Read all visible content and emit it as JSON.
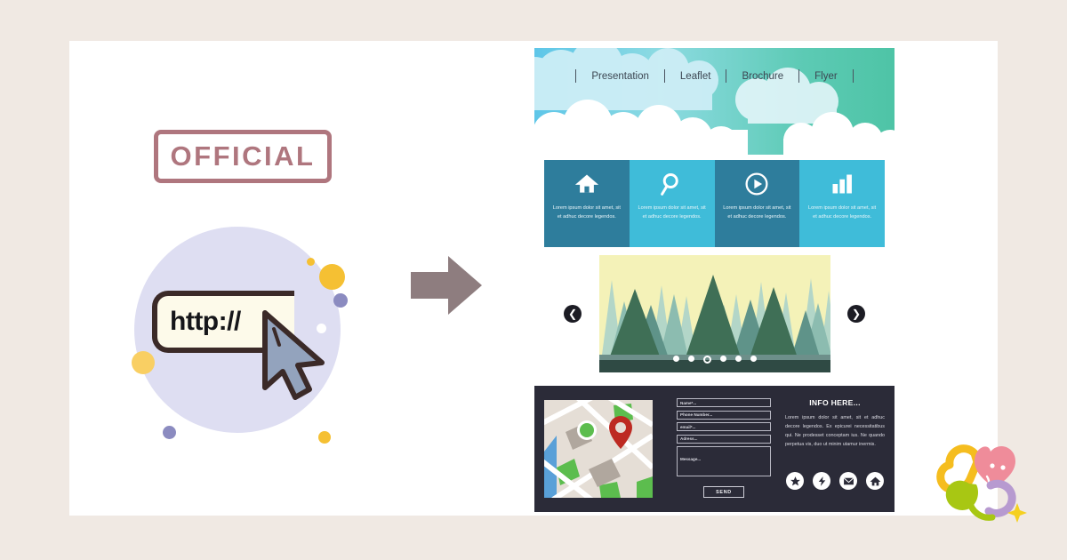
{
  "page": {
    "background_color": "#f0e9e3",
    "card_color": "#ffffff"
  },
  "left_panel": {
    "stamp": {
      "label": "OFFICIAL",
      "color": "#a96b74"
    },
    "url_bar": {
      "text": "http://",
      "fill": "#fdfaea",
      "stroke": "#3b2a28"
    },
    "cursor_icon": "mouse-pointer-icon",
    "circle_color": "#dedef2",
    "accent_yellow": "#f5c033",
    "accent_purple": "#8b8bc0",
    "arrow_icon": "right-arrow-icon",
    "arrow_color": "#8e7d7f"
  },
  "mockup": {
    "hero": {
      "sky_left": "#7fd0e8",
      "sky_right": "#55c9b0",
      "cloud_color": "#ffffff",
      "nav": [
        {
          "label": "Presentation"
        },
        {
          "label": "Leaflet"
        },
        {
          "label": "Brochure"
        },
        {
          "label": "Flyer"
        }
      ]
    },
    "tiles": [
      {
        "icon": "home-icon",
        "text": "Lorem ipsum dolor sit amet, sit et adhuc decore legendos.",
        "bg": "#2e7d9c"
      },
      {
        "icon": "search-icon",
        "text": "Lorem ipsum dolor sit amet, sit et adhuc decore legendos.",
        "bg": "#3fbcd9"
      },
      {
        "icon": "play-icon",
        "text": "Lorem ipsum dolor sit amet, sit et adhuc decore legendos.",
        "bg": "#2e7d9c"
      },
      {
        "icon": "bar-chart-icon",
        "text": "Lorem ipsum dolor sit amet, sit et adhuc decore legendos.",
        "bg": "#3fbcd9"
      }
    ],
    "carousel": {
      "prev_label": "❮",
      "next_label": "❯",
      "dot_count": 6,
      "active_dot": 3,
      "image_alt": "forest-pine-trees-illustration",
      "sky_color": "#f4f2b8",
      "tree_colors": [
        "#9fc9bd",
        "#7fb3a8",
        "#5d9289",
        "#3f6f5e",
        "#2e5a48"
      ]
    },
    "footer": {
      "background": "#2b2b38",
      "map": {
        "land_color": "#e5ded6",
        "road_color": "#ffffff",
        "park_color": "#5cbd4e",
        "water_color": "#59a0d8",
        "building_color": "#b0a79e",
        "pin_color": "#bd2a22",
        "pin_icon": "map-pin-icon",
        "marker_icon": "map-dot-icon"
      },
      "form": {
        "fields": [
          {
            "placeholder": "Name*..."
          },
          {
            "placeholder": "Phone Number..."
          },
          {
            "placeholder": "email*..."
          },
          {
            "placeholder": "Adress..."
          }
        ],
        "message_placeholder": "Message...",
        "submit_label": "SEND"
      },
      "info": {
        "heading": "INFO HERE...",
        "body": "Lorem ipsum dolor sit amet, sit et adhuc decore legendos. Ex epicurei necessitatibus qui. Ne prodesset conceptam ius. Ne quando perpetua vis, duo ut minim utamur inermis."
      },
      "socials": [
        {
          "icon": "star-icon"
        },
        {
          "icon": "share-lightning-icon"
        },
        {
          "icon": "envelope-icon"
        },
        {
          "icon": "home-icon"
        }
      ]
    }
  },
  "logo": {
    "name": "clover-logo",
    "petal_colors": [
      "#f5bd1f",
      "#ef8c9a",
      "#a8c713",
      "#b79ad0"
    ],
    "sparkle_color": "#f5d020"
  }
}
